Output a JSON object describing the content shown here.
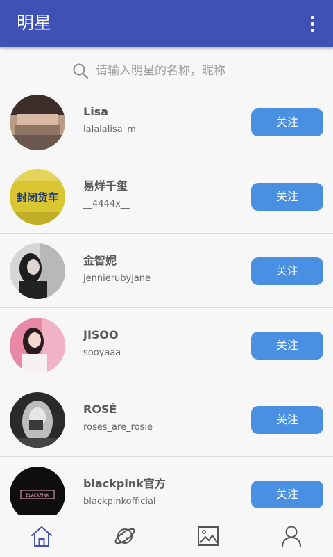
{
  "app_bar": {
    "title": "明星",
    "menu_icon": "more-vert-icon"
  },
  "search": {
    "icon": "search-icon",
    "placeholder": "请输入明星的名称，昵称",
    "value": ""
  },
  "stars": [
    {
      "name": "Lisa",
      "handle": "lalalalisa_m",
      "follow_label": "关注",
      "avatar_text": ""
    },
    {
      "name": "易烊千玺",
      "handle": "__4444x__",
      "follow_label": "关注",
      "avatar_text": "封闭货车"
    },
    {
      "name": "金智妮",
      "handle": "jennierubyjane",
      "follow_label": "关注",
      "avatar_text": ""
    },
    {
      "name": "JISOO",
      "handle": "sooyaaa__",
      "follow_label": "关注",
      "avatar_text": ""
    },
    {
      "name": "ROSÉ",
      "handle": "roses_are_rosie",
      "follow_label": "关注",
      "avatar_text": ""
    },
    {
      "name": "blackpink官方",
      "handle": "blackpinkofficial",
      "follow_label": "关注",
      "avatar_text": "BLACKPINK"
    }
  ],
  "bottom_nav": {
    "items": [
      {
        "icon": "home-icon",
        "active": true
      },
      {
        "icon": "planet-icon",
        "active": false
      },
      {
        "icon": "image-icon",
        "active": false
      },
      {
        "icon": "profile-icon",
        "active": false
      }
    ]
  },
  "colors": {
    "primary": "#3f51b5",
    "button": "#4a90e2",
    "active_nav": "#3f51b5",
    "inactive_nav": "#555555"
  }
}
